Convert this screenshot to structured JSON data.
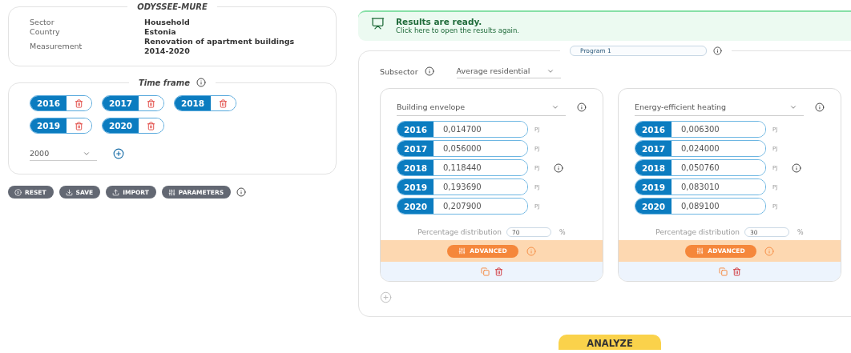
{
  "info": {
    "title": "ODYSSEE-MURE",
    "rows": [
      {
        "label": "Sector",
        "value": "Household"
      },
      {
        "label": "Country",
        "value": "Estonia"
      },
      {
        "label": "Measurement",
        "value": "Renovation of apartment buildings 2014-2020"
      }
    ]
  },
  "time_frame": {
    "title": "Time frame",
    "years": [
      "2016",
      "2017",
      "2018",
      "2019",
      "2020"
    ],
    "select": {
      "value": "2000"
    }
  },
  "actions": [
    {
      "kind": "reset",
      "label": "RESET"
    },
    {
      "kind": "save",
      "label": "SAVE"
    },
    {
      "kind": "import",
      "label": "IMPORT"
    },
    {
      "kind": "parameters",
      "label": "PARAMETERS"
    }
  ],
  "banner": {
    "title": "Results are ready.",
    "text": "Click here to open the results again."
  },
  "program": {
    "name": "Program 1",
    "subsector": {
      "label": "Subsector",
      "value": "Average residential"
    },
    "measures": [
      {
        "name": "Building envelope",
        "values": [
          {
            "year": "2016",
            "value": "0,014700",
            "unit": "PJ"
          },
          {
            "year": "2017",
            "value": "0,056000",
            "unit": "PJ"
          },
          {
            "year": "2018",
            "value": "0,118440",
            "unit": "PJ"
          },
          {
            "year": "2019",
            "value": "0,193690",
            "unit": "PJ"
          },
          {
            "year": "2020",
            "value": "0,207900",
            "unit": "PJ"
          }
        ],
        "percentage": {
          "label": "Percentage distribution",
          "value": "70",
          "unit": "%"
        },
        "advanced": "ADVANCED"
      },
      {
        "name": "Energy-efficient heating",
        "values": [
          {
            "year": "2016",
            "value": "0,006300",
            "unit": "PJ"
          },
          {
            "year": "2017",
            "value": "0,024000",
            "unit": "PJ"
          },
          {
            "year": "2018",
            "value": "0,050760",
            "unit": "PJ"
          },
          {
            "year": "2019",
            "value": "0,083010",
            "unit": "PJ"
          },
          {
            "year": "2020",
            "value": "0,089100",
            "unit": "PJ"
          }
        ],
        "percentage": {
          "label": "Percentage distribution",
          "value": "30",
          "unit": "%"
        },
        "advanced": "ADVANCED"
      }
    ]
  },
  "analyze": "ANALYZE"
}
